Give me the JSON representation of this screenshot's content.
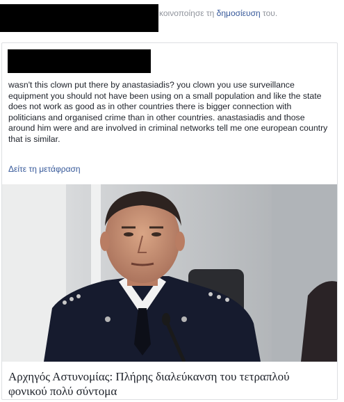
{
  "header": {
    "shared_text": "κοινοποίησε τη",
    "post_link": "δημοσίευση",
    "suffix": "του."
  },
  "post": {
    "body": "wasn't this clown put there by anastasiadis? you clown you use surveillance equipment you should not have been using on a small population and like the state does not work as good as in other countries there is bigger connection with politicians and organised crime than in other countries. anastasiadis and those around him were and are involved in criminal networks tell me one european country that is similar.",
    "translate_label": "Δείτε τη μετάφραση"
  },
  "link_preview": {
    "title": "Αρχηγός Αστυνομίας: Πλήρης διαλεύκανση του τετραπλού φονικού πολύ σύντομα"
  }
}
